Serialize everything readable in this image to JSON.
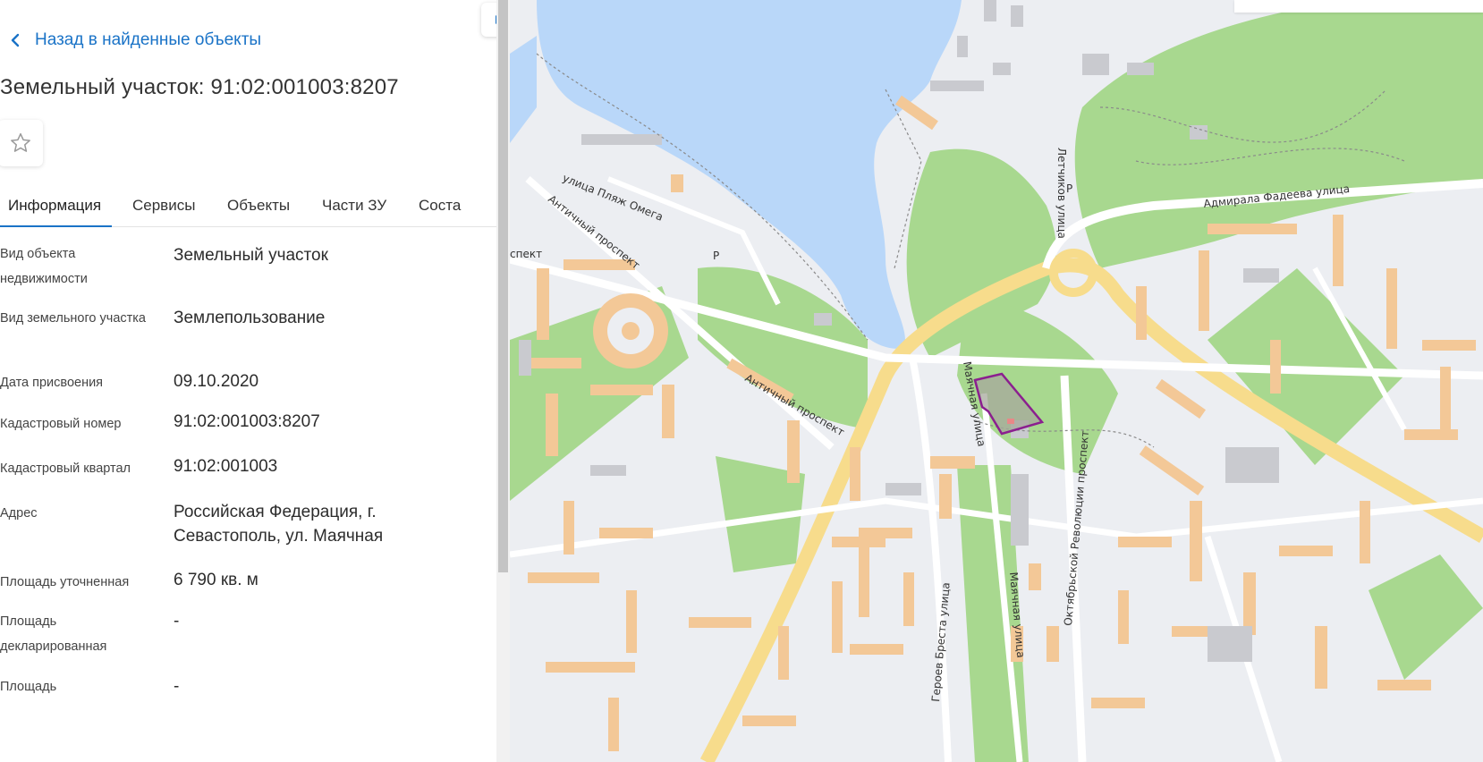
{
  "nav": {
    "back_label": "Назад в найденные объекты"
  },
  "object": {
    "title": "Земельный участок: 91:02:001003:8207"
  },
  "icons": {
    "back": "chevron-left-icon",
    "favorite": "star-icon",
    "tabs_next": "chevron-right-icon"
  },
  "colors": {
    "accent": "#1a73c7",
    "parcel_outline": "#8b1f8f"
  },
  "tabs": [
    {
      "label": "Информация",
      "active": true
    },
    {
      "label": "Сервисы",
      "active": false
    },
    {
      "label": "Объекты",
      "active": false
    },
    {
      "label": "Части ЗУ",
      "active": false
    },
    {
      "label": "Соста",
      "active": false
    }
  ],
  "properties": [
    {
      "label": "Вид объекта недвижимости",
      "value": "Земельный участок"
    },
    {
      "label": "Вид земельного участка",
      "value": "Землепользование"
    },
    {
      "label": "Дата присвоения",
      "value": "09.10.2020"
    },
    {
      "label": "Кадастровый номер",
      "value": "91:02:001003:8207"
    },
    {
      "label": "Кадастровый квартал",
      "value": "91:02:001003"
    },
    {
      "label": "Адрес",
      "value": "Российская Федерация, г. Севастополь, ул. Маячная"
    },
    {
      "label": "Площадь уточненная",
      "value": "6 790 кв. м"
    },
    {
      "label": "Площадь декларированная",
      "value": "-"
    },
    {
      "label": "Площадь",
      "value": "-"
    }
  ],
  "map": {
    "street_labels": [
      "улица Пляж Омега",
      "Античный проспект",
      "Античный проспект",
      "спект",
      "Летчиков улица",
      "Адмирала Фадеева улица",
      "Маячная улица",
      "Маячная улица",
      "Октябрьской Революции проспект",
      "Героев Бреста улица",
      "P",
      "P"
    ]
  }
}
